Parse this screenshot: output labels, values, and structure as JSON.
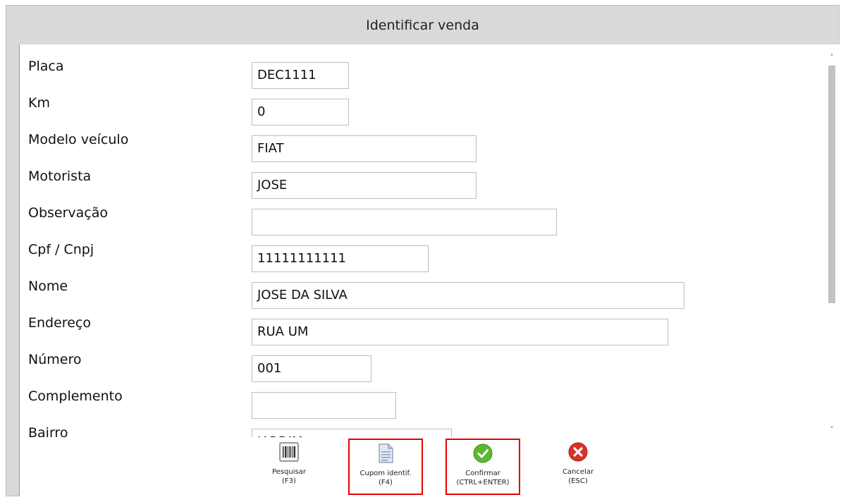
{
  "dialog": {
    "title": "Identificar venda"
  },
  "form": {
    "fields": [
      {
        "label": "Placa",
        "value": "DEC1111"
      },
      {
        "label": "Km",
        "value": "0"
      },
      {
        "label": "Modelo veículo",
        "value": "FIAT"
      },
      {
        "label": "Motorista",
        "value": "JOSE"
      },
      {
        "label": "Observação",
        "value": ""
      },
      {
        "label": "Cpf / Cnpj",
        "value": "11111111111"
      },
      {
        "label": "Nome",
        "value": "JOSE DA SILVA"
      },
      {
        "label": "Endereço",
        "value": "RUA UM"
      },
      {
        "label": "Número",
        "value": "001"
      },
      {
        "label": "Complemento",
        "value": ""
      },
      {
        "label": "Bairro",
        "value": "JARDIM"
      }
    ]
  },
  "scrollbar": {
    "up_arrow": "˄",
    "down_arrow": "˅"
  },
  "toolbar": {
    "buttons": [
      {
        "label": "Pesquisar",
        "key": "(F3)",
        "icon": "barcode-icon"
      },
      {
        "label": "Cupom identif.",
        "key": "(F4)",
        "icon": "document-icon"
      },
      {
        "label": "Confirmar",
        "key": "(CTRL+ENTER)",
        "icon": "checkmark-icon"
      },
      {
        "label": "Cancelar",
        "key": "(ESC)",
        "icon": "cancel-icon"
      }
    ]
  },
  "colors": {
    "highlight": "#e00000",
    "confirm_green": "#5cb82e",
    "cancel_red": "#d9302a"
  }
}
